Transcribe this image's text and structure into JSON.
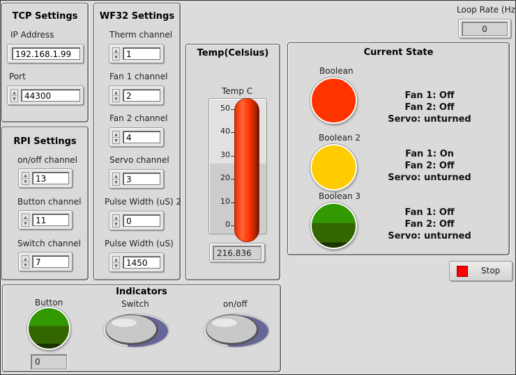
{
  "loop_rate": {
    "label": "Loop Rate (Hz)",
    "value": "0"
  },
  "tcp": {
    "title": "TCP Settings",
    "ip_label": "IP Address",
    "ip_value": "192.168.1.99",
    "port_label": "Port",
    "port_value": "44300"
  },
  "rpi": {
    "title": "RPI Settings",
    "fields": [
      {
        "label": "on/off channel",
        "value": "13"
      },
      {
        "label": "Button channel",
        "value": "11"
      },
      {
        "label": "Switch channel",
        "value": "7"
      }
    ]
  },
  "wf32": {
    "title": "WF32 Settings",
    "fields": [
      {
        "label": "Therm  channel",
        "value": "1"
      },
      {
        "label": "Fan 1 channel",
        "value": "2"
      },
      {
        "label": "Fan 2 channel",
        "value": "4"
      },
      {
        "label": "Servo  channel",
        "value": "3"
      },
      {
        "label": "Pulse Width (uS) 2",
        "value": "0"
      },
      {
        "label": "Pulse Width (uS)",
        "value": "1450"
      }
    ]
  },
  "temp": {
    "title": "Temp(Celsius)",
    "gauge_label": "Temp C",
    "scale": [
      "50",
      "40",
      "30",
      "20",
      "10",
      "0"
    ],
    "scale_min": 0,
    "scale_max": 50,
    "value": "216.836",
    "fill_color": "#ff3300"
  },
  "state": {
    "title": "Current State",
    "items": [
      {
        "label": "Boolean",
        "color": "#ff3300",
        "lines": [
          "Fan 1: Off",
          "Fan 2: Off",
          "Servo: unturned"
        ]
      },
      {
        "label": "Boolean 2",
        "color": "#ffcc00",
        "lines": [
          "Fan 1: On",
          "Fan 2: Off",
          "Servo: unturned"
        ]
      },
      {
        "label": "Boolean 3",
        "color": "#339900",
        "lines": [
          "Fan 1: Off",
          "Fan 2: Off",
          "Servo: unturned"
        ]
      }
    ]
  },
  "stop": {
    "label": "Stop",
    "color": "#ff0000"
  },
  "indicators": {
    "title": "Indicators",
    "button_label": "Button",
    "button_value": "0",
    "switch_label": "Switch",
    "onoff_label": "on/off"
  }
}
